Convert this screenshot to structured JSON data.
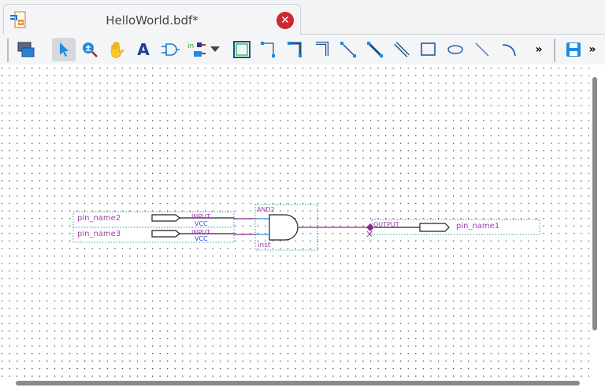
{
  "tab": {
    "title": "HelloWorld.bdf*",
    "close_icon": "close-icon"
  },
  "toolbar": {
    "tools": [
      "window-icon",
      "select-icon",
      "zoom-icon",
      "hand-icon",
      "text-icon",
      "symbol-icon",
      "pin-icon",
      "dropdown-icon",
      "block-icon",
      "orthogonal-node-icon",
      "orthogonal-bus-icon",
      "orthogonal-conduit-icon",
      "node-icon",
      "bus-icon",
      "conduit-icon",
      "rectangle-icon",
      "oval-icon",
      "line-icon",
      "arc-icon",
      "more-icon",
      "save-icon",
      "more-icon"
    ],
    "more": "»",
    "active_tool": "select-icon"
  },
  "schematic": {
    "inputs": [
      {
        "name": "pin_name2",
        "type": "INPUT",
        "default": "VCC"
      },
      {
        "name": "pin_name3",
        "type": "INPUT",
        "default": "VCC"
      }
    ],
    "gate": {
      "type": "AND2",
      "instance": "inst"
    },
    "output": {
      "name": "pin_name1",
      "type": "OUTPUT"
    }
  },
  "colors": {
    "wire": "#8a2a8a",
    "label": "#a040b0",
    "default": "#3050e0",
    "boundary": "#2aa0a0",
    "select": "#3a8fe0"
  }
}
